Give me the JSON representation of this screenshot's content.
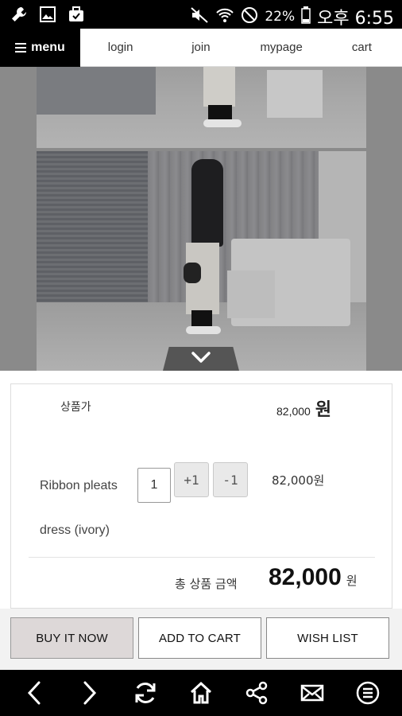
{
  "status_bar": {
    "left_icons": [
      "wrench-icon",
      "image-icon",
      "bag-check-icon"
    ],
    "right_icons": [
      "mute-icon",
      "wifi-icon",
      "no-sign-icon",
      "battery-icon"
    ],
    "battery_percent": "22%",
    "time": "오후 6:55"
  },
  "nav": {
    "menu_label": "menu",
    "items": [
      {
        "label": "login"
      },
      {
        "label": "join"
      },
      {
        "label": "mypage"
      },
      {
        "label": "cart"
      }
    ]
  },
  "product": {
    "price_label": "상품가",
    "price_amount": "82,000",
    "price_unit": "원",
    "name": "Ribbon pleats dress (ivory)",
    "quantity": "1",
    "plus_label": "+1",
    "minus_label": "-1",
    "line_price": "82,000원",
    "total_label": "총 상품 금액",
    "total_amount": "82,000",
    "total_unit": "원"
  },
  "actions": {
    "buy": "BUY IT NOW",
    "cart": "ADD TO CART",
    "wish": "WISH LIST"
  },
  "browser_bar": {
    "icons": [
      "back-icon",
      "forward-icon",
      "refresh-icon",
      "home-icon",
      "share-icon",
      "mail-icon",
      "menu-circle-icon"
    ]
  },
  "colors": {
    "nav_menu_bg": "#000000",
    "buy_button_bg": "#ddd8d8",
    "status_bar_bg": "#000000"
  }
}
